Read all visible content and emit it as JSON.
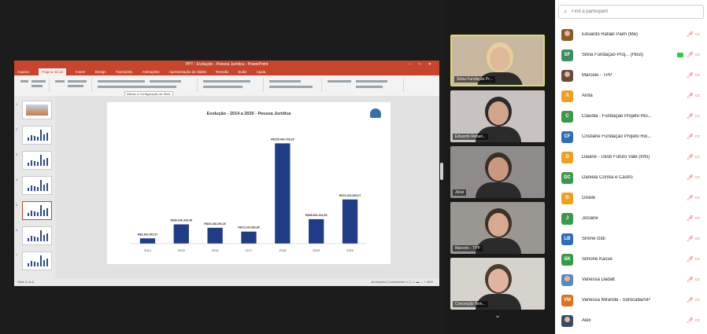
{
  "ppt": {
    "title": "PPT - Evolução - Pessoa Jurídica - PowerPoint",
    "window_controls": "–  □  ✕",
    "tabs": [
      "Arquivo",
      "Página Inicial",
      "Inserir",
      "Design",
      "Transições",
      "Animações",
      "Apresentação de Slides",
      "Revisão",
      "Exibir",
      "Ajuda"
    ],
    "slide_title": "Evolução - 2014 a 2020 - Pessoa Jurídica",
    "status_left": "Slide 5 de 6",
    "status_right": "Anotações   Comentários   ▭ ▯ ▭ ▬ — + 66%",
    "tooltip": "Alterar a Configuração de Slide",
    "thumbs": [
      {
        "num": "1",
        "type": "image"
      },
      {
        "num": "2",
        "type": "chart"
      },
      {
        "num": "3",
        "type": "chart"
      },
      {
        "num": "4",
        "type": "chart"
      },
      {
        "num": "5",
        "type": "chart",
        "selected": true
      },
      {
        "num": "6",
        "type": "chart"
      },
      {
        "num": "7",
        "type": "chart"
      }
    ]
  },
  "chart_data": {
    "type": "bar",
    "title": "Evolução - 2014 a 2020 - Pessoa Jurídica",
    "categories": [
      "2014",
      "2015",
      "2016",
      "2017",
      "2018",
      "2019",
      "2020"
    ],
    "values": [
      8366452.57,
      30646329.48,
      25188266.26,
      19140883.85,
      159496768.28,
      38892164.59,
      70263365.07
    ],
    "labels": [
      "R$8.366.452,57",
      "R$30.646.329,48",
      "R$25.188.266,26",
      "R$19.140.883,85",
      "R$159.496.768,28",
      "R$38.892.164,59",
      "R$70.263.365,07"
    ],
    "ylim": [
      0,
      175000000
    ],
    "bar_color": "#1f3c87"
  },
  "videos": [
    {
      "name": "Silvia Fundação Pr...",
      "active": true,
      "bg": "#c9b8a0",
      "skin": "#e0b89a",
      "hair": "#e6cf9a"
    },
    {
      "name": "Eduardo Rafael...",
      "active": false,
      "bg": "#c8c3c0",
      "skin": "#d2a58a",
      "hair": "#2a2a2a"
    },
    {
      "name": "Jéssi",
      "active": false,
      "bg": "#8d8c8a",
      "skin": "#c99880",
      "hair": "#3a2e28"
    },
    {
      "name": "Marcelo - TPP",
      "active": false,
      "bg": "#9a9792",
      "skin": "#d6aa90",
      "hair": "#3e3026"
    },
    {
      "name": "Conceição Tom...",
      "active": false,
      "bg": "#d6d2cc",
      "skin": "#e0b4a0",
      "hair": "#4a3c30"
    }
  ],
  "video_scroll_icon": "⌄",
  "search": {
    "placeholder": "Find a participant"
  },
  "participants": [
    {
      "name": "Eduardo Rafael Paim (Me)",
      "initials": "",
      "color": "#8b5a2b",
      "photo": true
    },
    {
      "name": "Silvia Fundação Proj... (Host)",
      "initials": "SF",
      "color": "#3a8f5c",
      "photo": false,
      "sharing": true
    },
    {
      "name": "Marcelo - TPP",
      "initials": "",
      "color": "#6a4a3a",
      "photo": true
    },
    {
      "name": "Anita",
      "initials": "A",
      "color": "#f0a020",
      "photo": false
    },
    {
      "name": "Claudia - Fundação Projeto Rio...",
      "initials": "C",
      "color": "#3a9a4a",
      "photo": false
    },
    {
      "name": "Cristiane Fundação Projeto Rio...",
      "initials": "CF",
      "color": "#2e6db8",
      "photo": false
    },
    {
      "name": "Daiane - Uesb Futuro Vale (Info)",
      "initials": "D",
      "color": "#f0a020",
      "photo": false
    },
    {
      "name": "Daniela Corrêa e Castro",
      "initials": "DC",
      "color": "#3a9a4a",
      "photo": false
    },
    {
      "name": "Gisele",
      "initials": "G",
      "color": "#f0a020",
      "photo": false
    },
    {
      "name": "Jociane",
      "initials": "J",
      "color": "#3a9a4a",
      "photo": false
    },
    {
      "name": "Sirene Izidi",
      "initials": "LB",
      "color": "#2e6db8",
      "photo": false
    },
    {
      "name": "Simone Kassé",
      "initials": "SK",
      "color": "#3a9a4a",
      "photo": false
    },
    {
      "name": "Vanessa Dadalt",
      "initials": "",
      "color": "#5a8ac0",
      "photo": true
    },
    {
      "name": "Vanessa Miranda - Sorocaba/SP",
      "initials": "VM",
      "color": "#e07020",
      "photo": false
    },
    {
      "name": "Alex",
      "initials": "",
      "color": "#3a4a6a",
      "photo": true
    }
  ],
  "mic_icon": "🎤︎",
  "cam_icon": "▭"
}
